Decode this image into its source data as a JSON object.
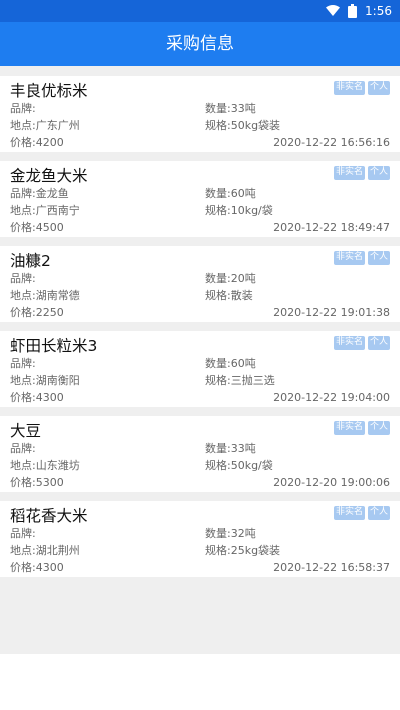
{
  "status_bar": {
    "time": "1:56",
    "icons": [
      "wifi-icon",
      "battery-icon"
    ]
  },
  "app_bar": {
    "title": "采购信息"
  },
  "colors": {
    "status_bar": "#1565d8",
    "app_bar": "#1e7df0",
    "tag": "#a7c9f1",
    "list_bg": "#efefef"
  },
  "listings": [
    {
      "title": "丰良优标米",
      "tags": [
        "非实名",
        "个人"
      ],
      "brand": "品牌:",
      "quantity": "数量:33吨",
      "location": "地点:广东广州",
      "spec": "规格:50kg袋装",
      "price": "价格:4200",
      "time": "2020-12-22 16:56:16"
    },
    {
      "title": "金龙鱼大米",
      "tags": [
        "非实名",
        "个人"
      ],
      "brand": "品牌:金龙鱼",
      "quantity": "数量:60吨",
      "location": "地点:广西南宁",
      "spec": "规格:10kg/袋",
      "price": "价格:4500",
      "time": "2020-12-22 18:49:47"
    },
    {
      "title": "油糠2",
      "tags": [
        "非实名",
        "个人"
      ],
      "brand": "品牌:",
      "quantity": "数量:20吨",
      "location": "地点:湖南常德",
      "spec": "规格:散装",
      "price": "价格:2250",
      "time": "2020-12-22 19:01:38"
    },
    {
      "title": "虾田长粒米3",
      "tags": [
        "非实名",
        "个人"
      ],
      "brand": "品牌:",
      "quantity": "数量:60吨",
      "location": "地点:湖南衡阳",
      "spec": "规格:三抛三选",
      "price": "价格:4300",
      "time": "2020-12-22 19:04:00"
    },
    {
      "title": "大豆",
      "tags": [
        "非实名",
        "个人"
      ],
      "brand": "品牌:",
      "quantity": "数量:33吨",
      "location": "地点:山东潍坊",
      "spec": "规格:50kg/袋",
      "price": "价格:5300",
      "time": "2020-12-20 19:00:06"
    },
    {
      "title": "稻花香大米",
      "tags": [
        "非实名",
        "个人"
      ],
      "brand": "品牌:",
      "quantity": "数量:32吨",
      "location": "地点:湖北荆州",
      "spec": "规格:25kg袋装",
      "price": "价格:4300",
      "time": "2020-12-22 16:58:37"
    }
  ]
}
